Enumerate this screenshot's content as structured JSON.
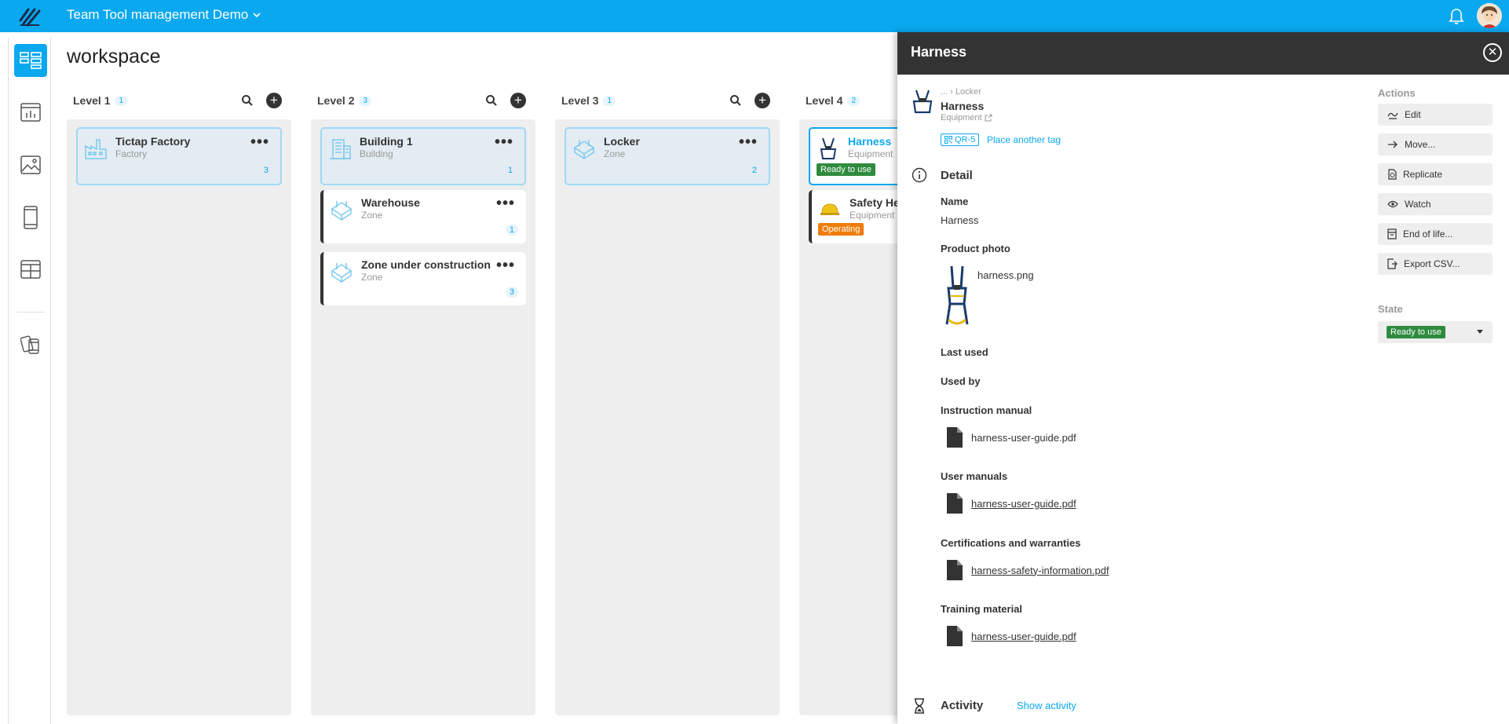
{
  "header": {
    "app_title": "Team Tool management Demo",
    "accent_color": "#0aa8ef"
  },
  "sidebar": {
    "items": [
      {
        "icon": "workspace-board-icon",
        "active": true
      },
      {
        "icon": "dashboard-chart-icon"
      },
      {
        "icon": "gallery-image-icon"
      },
      {
        "icon": "mobile-device-icon"
      },
      {
        "icon": "layout-template-icon"
      },
      {
        "icon": "devices-tags-icon"
      }
    ]
  },
  "page": {
    "title": "workspace"
  },
  "columns": [
    {
      "title": "Level 1",
      "count": "1",
      "cards": [
        {
          "title": "Tictap Factory",
          "subtitle": "Factory",
          "count": "3",
          "icon": "factory-icon",
          "selected": true
        }
      ]
    },
    {
      "title": "Level 2",
      "count": "3",
      "cards": [
        {
          "title": "Building 1",
          "subtitle": "Building",
          "count": "1",
          "icon": "building-icon",
          "selected": true
        },
        {
          "title": "Warehouse",
          "subtitle": "Zone",
          "count": "1",
          "icon": "zone-icon"
        },
        {
          "title": "Zone under construction",
          "subtitle": "Zone",
          "count": "3",
          "icon": "zone-icon"
        }
      ]
    },
    {
      "title": "Level 3",
      "count": "1",
      "cards": [
        {
          "title": "Locker",
          "subtitle": "Zone",
          "count": "2",
          "icon": "zone-icon",
          "selected": true
        }
      ]
    },
    {
      "title": "Level 4",
      "count": "2",
      "cards": [
        {
          "title": "Harness",
          "subtitle": "Equipment",
          "badge": "Ready to use",
          "badge_color": "#2e8b3e",
          "icon": "harness-thumbnail",
          "selected": true
        },
        {
          "title": "Safety He",
          "subtitle": "Equipment",
          "badge": "Operating",
          "badge_color": "#f07c0a",
          "icon": "helmet-thumbnail"
        }
      ]
    }
  ],
  "panel": {
    "title": "Harness",
    "breadcrumb": "... › Locker",
    "name": "Harness",
    "type": "Equipment",
    "qr_tag": "QR-5",
    "place_tag": "Place another tag",
    "detail_heading": "Detail",
    "name_label": "Name",
    "name_value": "Harness",
    "photo_label": "Product photo",
    "photo_file": "harness.png",
    "last_used_label": "Last used",
    "used_by_label": "Used by",
    "instruction_label": "Instruction manual",
    "instruction_file": "harness-user-guide.pdf",
    "user_manuals_label": "User manuals",
    "user_manuals_file": "harness-user-guide.pdf",
    "cert_label": "Certifications and warranties",
    "cert_file": "harness-safety-information.pdf",
    "training_label": "Training material",
    "training_file": "harness-user-guide.pdf",
    "activity_heading": "Activity",
    "show_activity": "Show activity",
    "actions_heading": "Actions",
    "actions": [
      "Edit",
      "Move...",
      "Replicate",
      "Watch",
      "End of life...",
      "Export CSV..."
    ],
    "state_heading": "State",
    "state_value": "Ready to use",
    "state_color": "#2e8b3e"
  }
}
